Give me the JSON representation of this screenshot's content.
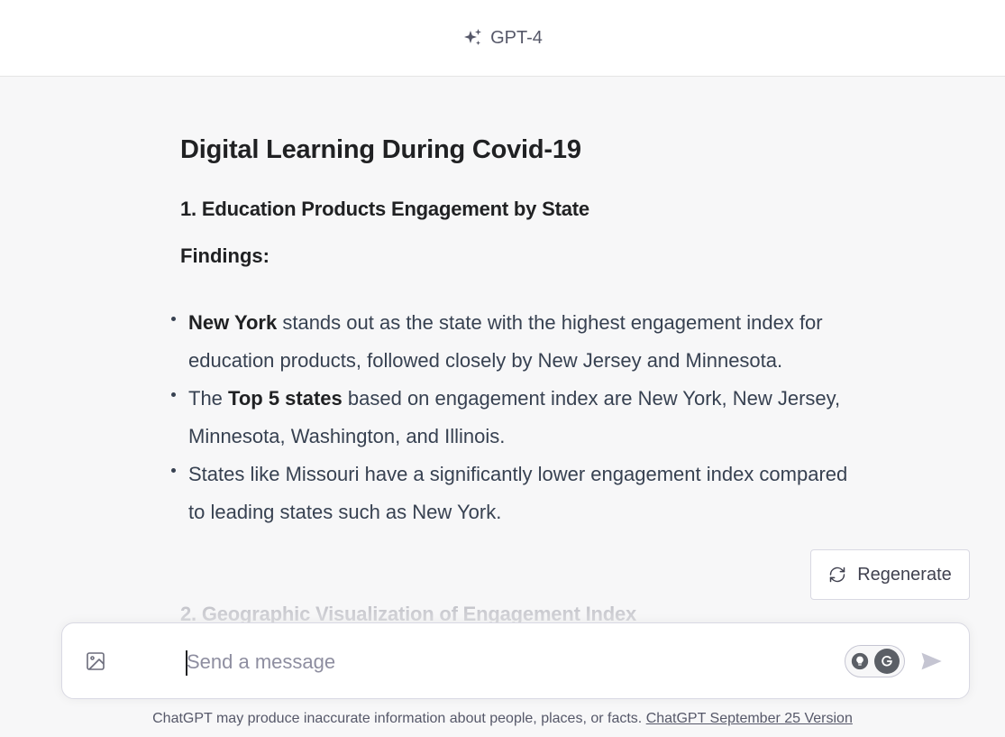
{
  "header": {
    "model_name": "GPT-4",
    "icon": "sparkle-icon"
  },
  "message": {
    "title": "Digital Learning During Covid-19",
    "section1_heading": "1. Education Products Engagement by State",
    "findings_label": "Findings:",
    "bullets": [
      {
        "bold": "New York",
        "rest": " stands out as the state with the highest engagement index for education products, followed closely by New Jersey and Minnesota."
      },
      {
        "pre": "The ",
        "bold": "Top 5 states",
        "rest": " based on engagement index are New York, New Jersey, Minnesota, Washington, and Illinois."
      },
      {
        "text": "States like Missouri have a significantly lower engagement index compared to leading states such as New York."
      }
    ],
    "section2_heading": "2. Geographic Visualization of Engagement Index"
  },
  "regenerate": {
    "label": "Regenerate",
    "icon": "refresh-icon"
  },
  "composer": {
    "placeholder": "Send a message",
    "value": "",
    "image_icon": "image-icon",
    "send_icon": "send-icon",
    "extension_icons": [
      "lightbulb-icon",
      "grammarly-icon"
    ]
  },
  "footer": {
    "disclaimer": "ChatGPT may produce inaccurate information about people, places, or facts.",
    "version_link": "ChatGPT September 25 Version"
  },
  "colors": {
    "background": "#f7f7f8",
    "header_bg": "#ffffff",
    "text_primary": "#202123",
    "text_muted": "#8e8ea0"
  }
}
